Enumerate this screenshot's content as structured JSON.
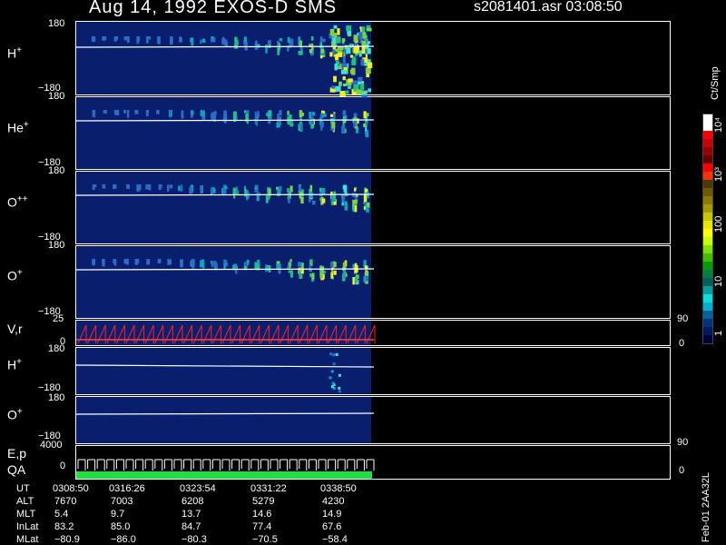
{
  "header": {
    "title": "Aug 14, 1992    EXOS-D SMS",
    "file_time": "s2081401.asr  03:08:50"
  },
  "panels": [
    {
      "label": "H",
      "sup": "+",
      "ymax": "180",
      "ymin": "−180"
    },
    {
      "label": "He",
      "sup": "+",
      "ymax": "180",
      "ymin": "−180"
    },
    {
      "label": "O",
      "sup": "++",
      "ymax": "180",
      "ymin": "−180"
    },
    {
      "label": "O",
      "sup": "+",
      "ymax": "180",
      "ymin": "−180"
    }
  ],
  "vr_panel": {
    "label": "V,r",
    "left_top": "25",
    "left_bottom": "0",
    "right_top": "90",
    "right_bottom": "0"
  },
  "lower_panels": [
    {
      "label": "H",
      "sup": "+",
      "ymax": "180",
      "ymin": "−180"
    },
    {
      "label": "O",
      "sup": "+",
      "ymax": "180",
      "ymin": "−180"
    }
  ],
  "ep_panel": {
    "label1": "E,p",
    "label2": "QA",
    "left_top": "4000",
    "left_bottom": "0",
    "right_top": "90",
    "right_bottom": "0"
  },
  "colorbar": {
    "unit": "Ct/Smp",
    "ticks": [
      "10⁴",
      "10³",
      "100",
      "10",
      "1"
    ],
    "colors": [
      "#ffffff",
      "#ffffff",
      "#ff0000",
      "#cc0000",
      "#990000",
      "#660000",
      "#ff0000",
      "#ff3300",
      "#4a3a00",
      "#6e5a00",
      "#8a7a00",
      "#a89a00",
      "#c8c800",
      "#e8e800",
      "#ffff00",
      "#c8ff00",
      "#80e000",
      "#40c000",
      "#00a000",
      "#008040",
      "#006060",
      "#00a0a0",
      "#00e0e0",
      "#00b0d0",
      "#0060a0",
      "#003080",
      "#001a60",
      "#000040"
    ]
  },
  "footer_code": "Feb-01 2AA32L",
  "ephemeris": {
    "labels": [
      "UT",
      "ALT",
      "MLT",
      "InLat",
      "MLat"
    ],
    "columns": [
      [
        "0308:50",
        "7670",
        "5.4",
        "83.2",
        "−80.9"
      ],
      [
        "0316:26",
        "7003",
        "9.7",
        "85.0",
        "−86.0"
      ],
      [
        "0323:54",
        "6208",
        "13.7",
        "84.7",
        "−80.3"
      ],
      [
        "0331:22",
        "5279",
        "14.6",
        "77.4",
        "−70.5"
      ],
      [
        "0338:50",
        "4230",
        "14.9",
        "67.6",
        "−58.4"
      ]
    ]
  }
}
